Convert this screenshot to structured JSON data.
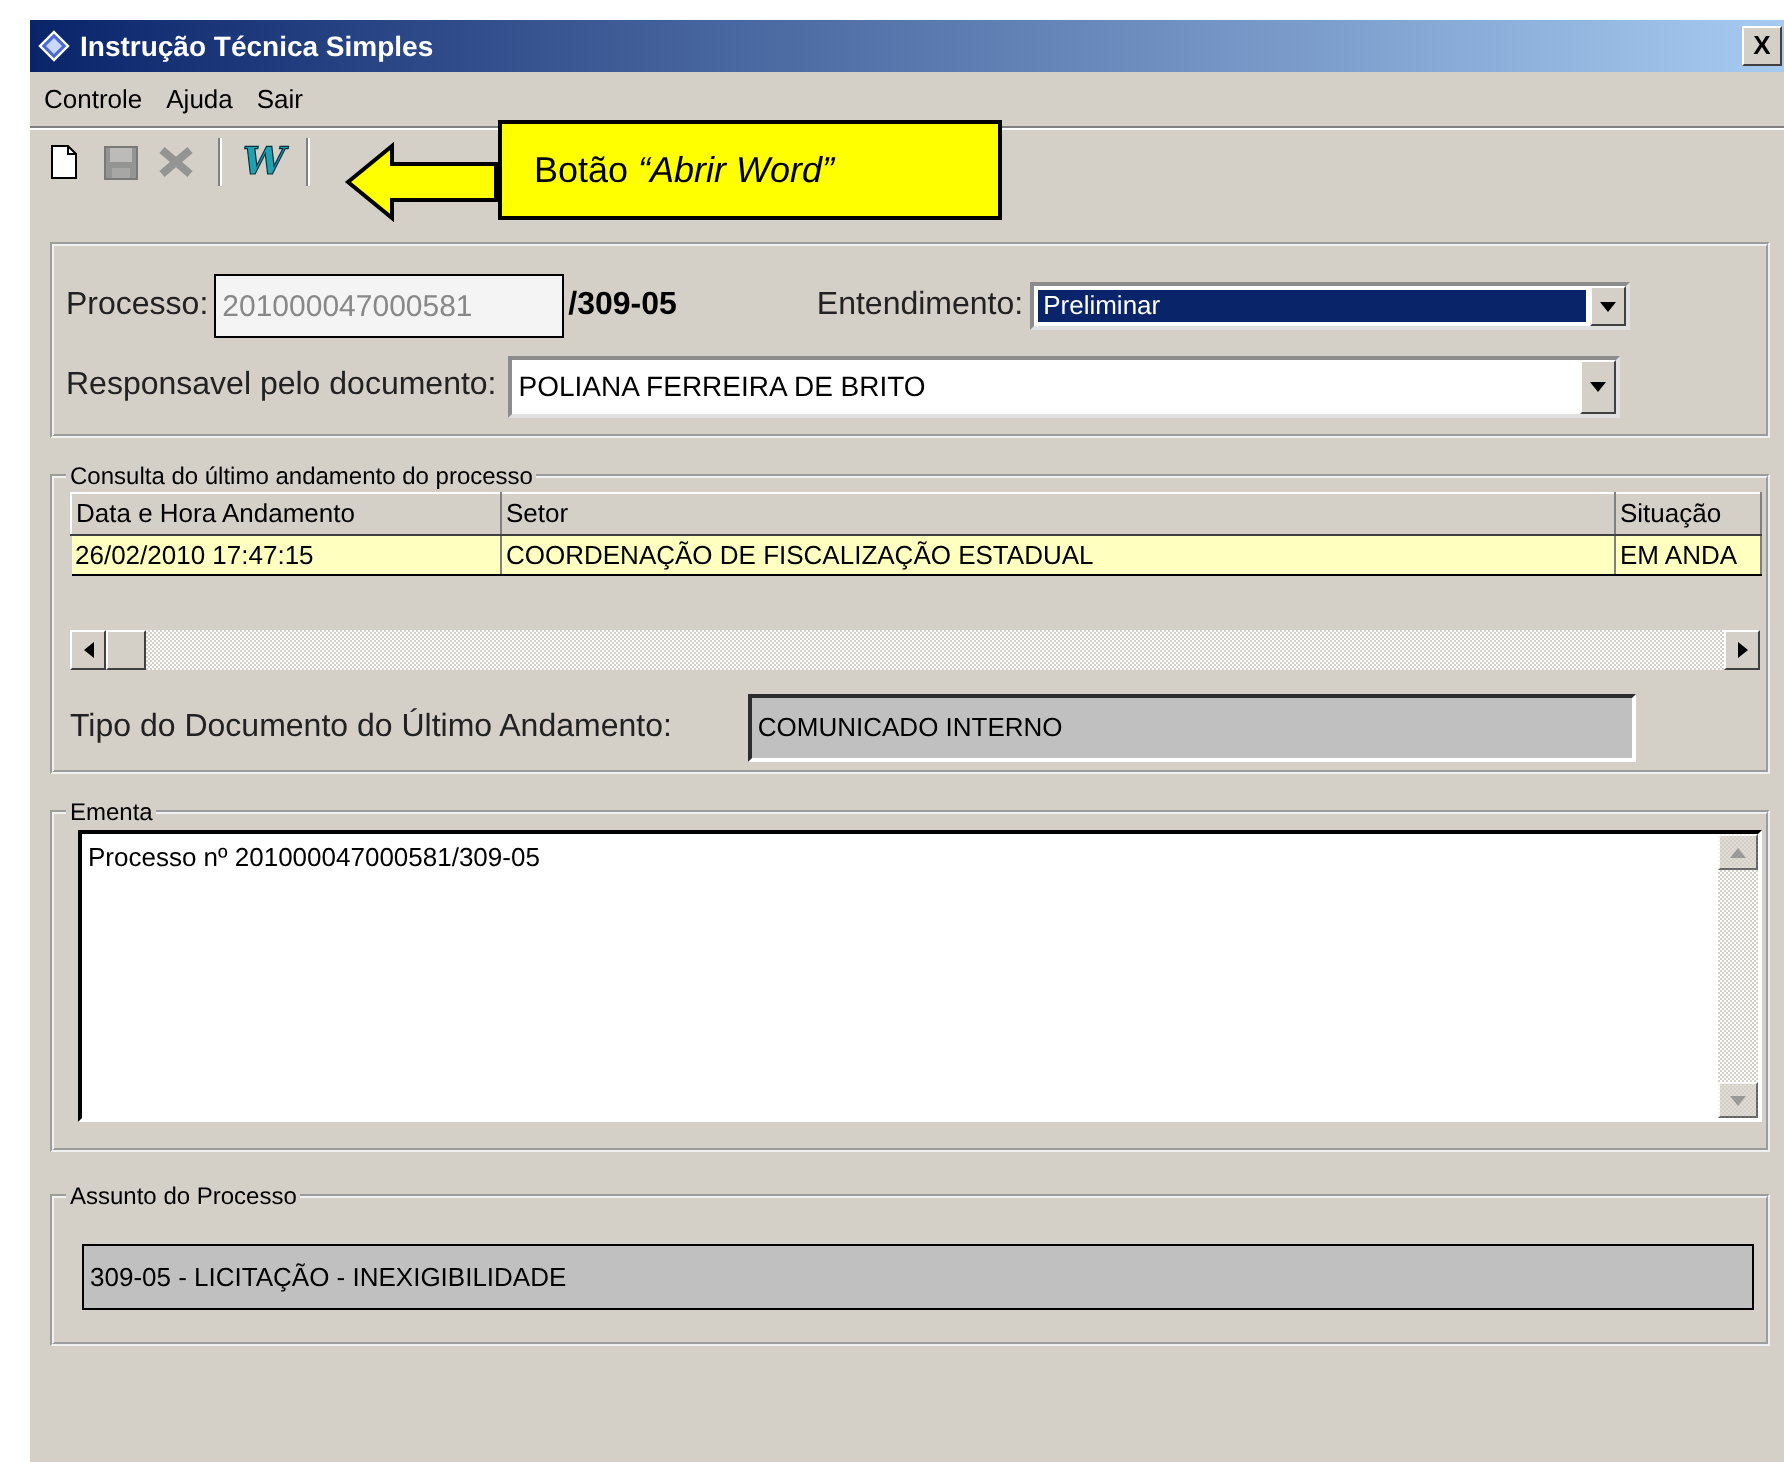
{
  "window": {
    "title": "Instrução Técnica Simples",
    "close": "X"
  },
  "menu": [
    "Controle",
    "Ajuda",
    "Sair"
  ],
  "toolbar": [
    {
      "kind": "new",
      "disabled": false
    },
    {
      "kind": "save",
      "disabled": true
    },
    {
      "kind": "delete",
      "disabled": true
    },
    {
      "kind": "separator"
    },
    {
      "kind": "word",
      "glyph": "W",
      "disabled": false
    },
    {
      "kind": "separator"
    }
  ],
  "callout": {
    "text": "Botão *“Abrir Word”*"
  },
  "processo": {
    "label": "Processo:",
    "value": "201000047000581",
    "suffix": "/309-05",
    "disabled": true
  },
  "entendimento": {
    "label": "Entendimento:",
    "value": "Preliminar",
    "focused": true
  },
  "responsavel": {
    "label": "Responsavel pelo documento:",
    "value": "POLIANA FERREIRA DE BRITO",
    "focused": false
  },
  "consulta": {
    "title": "Consulta do último andamento do processo",
    "table": {
      "columns": [
        "Data e Hora Andamento",
        "Setor",
        "Situação"
      ],
      "rows": [
        {
          "cells": [
            "26/02/2010 17:47:15",
            "COORDENAÇÃO DE FISCALIZAÇÃO ESTADUAL",
            "EM ANDA"
          ],
          "selected": true
        }
      ]
    },
    "tipo": {
      "label": "Tipo do Documento do Último Andamento:",
      "value": "COMUNICADO INTERNO"
    }
  },
  "ementa": {
    "title": "Ementa",
    "value": "Processo nº 201000047000581/309-05"
  },
  "assunto": {
    "title": "Assunto do Processo",
    "value": "309-05 - LICITAÇÃO - INEXIGIBILIDADE"
  }
}
